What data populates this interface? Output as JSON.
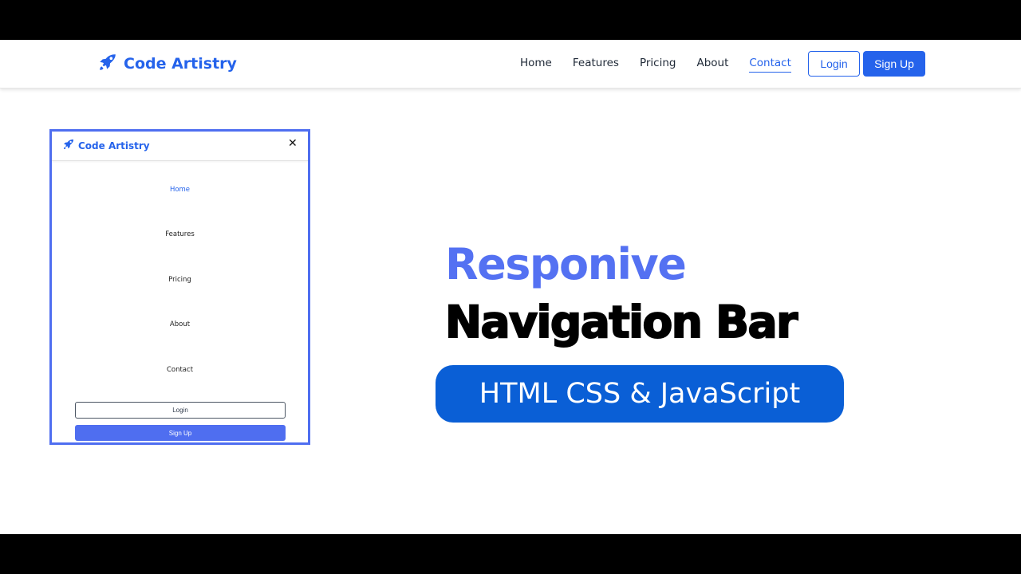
{
  "colors": {
    "brand": "#2563eb",
    "accent_light": "#5471f2",
    "pill_bg": "#0a5fd6",
    "text_dark": "#1f2937"
  },
  "navbar": {
    "brand_icon": "rocket-icon",
    "brand_name": "Code Artistry",
    "links": [
      {
        "label": "Home",
        "active": false
      },
      {
        "label": "Features",
        "active": false
      },
      {
        "label": "Pricing",
        "active": false
      },
      {
        "label": "About",
        "active": false
      },
      {
        "label": "Contact",
        "active": true
      }
    ],
    "login_label": "Login",
    "signup_label": "Sign Up"
  },
  "mobile_preview": {
    "brand_icon": "rocket-icon",
    "brand_name": "Code Artistry",
    "close_icon": "close-icon",
    "close_glyph": "✕",
    "links": [
      {
        "label": "Home",
        "active": true
      },
      {
        "label": "Features",
        "active": false
      },
      {
        "label": "Pricing",
        "active": false
      },
      {
        "label": "About",
        "active": false
      },
      {
        "label": "Contact",
        "active": false
      }
    ],
    "login_label": "Login",
    "signup_label": "Sign Up"
  },
  "headline": {
    "line1": "Responive",
    "line2": "Navigation Bar",
    "pill": "HTML CSS & JavaScript"
  }
}
